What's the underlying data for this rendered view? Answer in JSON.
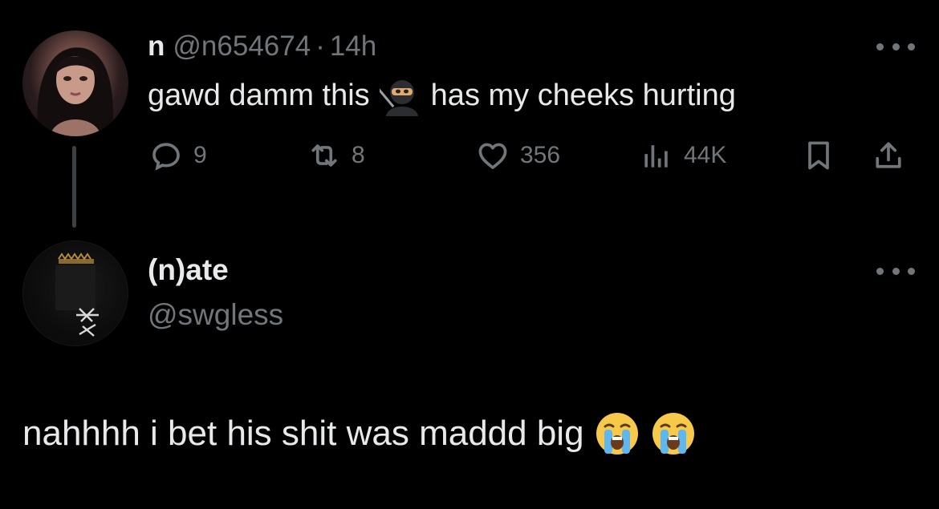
{
  "tweet1": {
    "display_name": "n",
    "handle": "@n654674",
    "separator": "·",
    "time": "14h",
    "text_before_emoji": "gawd damm this",
    "emoji": "ninja-emoji",
    "text_after_emoji": "has my cheeks hurting",
    "actions": {
      "reply_count": "9",
      "retweet_count": "8",
      "like_count": "356",
      "view_count": "44K"
    }
  },
  "tweet2": {
    "display_name": "(n)ate",
    "handle": "@swgless",
    "text": "nahhhh i bet his shit was maddd big",
    "emojis": [
      "loudly-crying-face-emoji",
      "loudly-crying-face-emoji"
    ]
  },
  "colors": {
    "background": "#000000",
    "primary_text": "#e7e9ea",
    "secondary_text": "#71767b",
    "thread_line": "#3e4144"
  }
}
